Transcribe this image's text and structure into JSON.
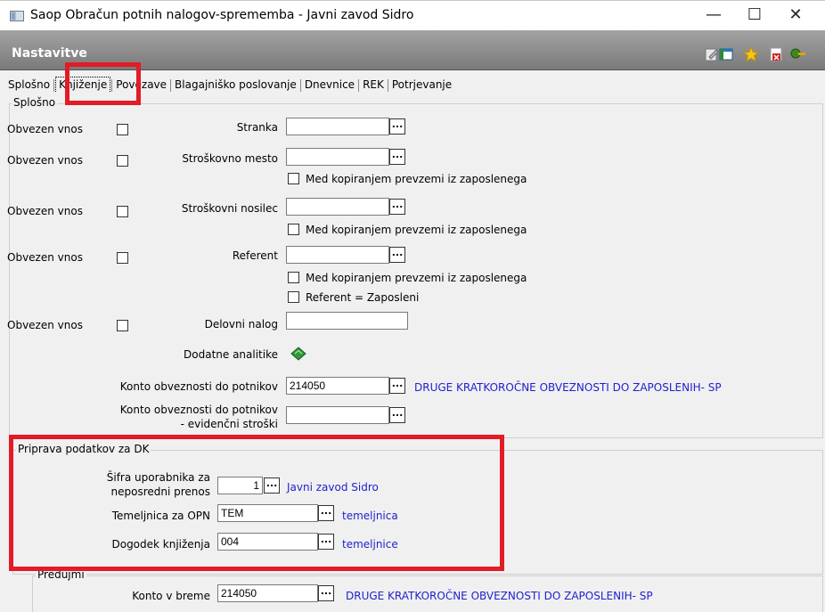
{
  "window": {
    "title": "Saop Obračun potnih nalogov-sprememba - Javni zavod Sidro",
    "minimize_icon": "minimize-icon",
    "maximize_icon": "maximize-icon",
    "close_icon": "close-icon"
  },
  "header": {
    "title": "Nastavitve",
    "toolbar_icons": [
      "edit-icon",
      "table-icon",
      "star-icon",
      "exit-icon",
      "green-key-icon"
    ]
  },
  "tabs": [
    {
      "label": "Splošno",
      "active": false
    },
    {
      "label": "Knjiženje",
      "active": true
    },
    {
      "label": "Povezave",
      "active": false
    },
    {
      "label": "Blagajniško poslovanje",
      "active": false
    },
    {
      "label": "Dnevnice",
      "active": false
    },
    {
      "label": "REK",
      "active": false
    },
    {
      "label": "Potrjevanje",
      "active": false
    }
  ],
  "splosno": {
    "group_label": "Splošno",
    "obvezen_label": "Obvezen vnos",
    "stranka_label": "Stranka",
    "strosk_mesto_label": "Stroškovno mesto",
    "strosk_nosilec_label": "Stroškovni nosilec",
    "referent_label": "Referent",
    "med_kop_label": "Med kopiranjem prevzemi iz zaposlenega",
    "referent_zaposleni_label": "Referent = Zaposleni",
    "delovni_nalog_label": "Delovni nalog",
    "dodatne_analitike_label": "Dodatne analitike",
    "konto_label": "Konto obveznosti do potnikov",
    "konto_value": "214050",
    "konto_desc": "DRUGE KRATKOROČNE OBVEZNOSTI DO ZAPOSLENIH- SP",
    "konto_evid_label_1": "Konto obveznosti do potnikov",
    "konto_evid_label_2": "- evidenčni stroški"
  },
  "dk": {
    "group_label": "Priprava podatkov za DK",
    "sifra_label_1": "Šifra uporabnika za",
    "sifra_label_2": "neposredni prenos",
    "sifra_value": "1",
    "sifra_desc": "Javni zavod Sidro",
    "temeljnica_label": "Temeljnica za OPN",
    "temeljnica_value": "TEM",
    "temeljnica_desc": "temeljnica",
    "dogodek_label": "Dogodek knjiženja",
    "dogodek_value": "004",
    "dogodek_desc": "temeljnice"
  },
  "predujmi": {
    "group_label": "Predujmi",
    "konto_breme_label": "Konto v breme",
    "konto_breme_value": "214050",
    "konto_breme_desc": "DRUGE KRATKOROČNE OBVEZNOSTI DO ZAPOSLENIH- SP"
  },
  "dots_label": "...",
  "colors": {
    "highlight": "#e21b25",
    "link": "#1f1fcf",
    "header": "#8c8c8c"
  }
}
